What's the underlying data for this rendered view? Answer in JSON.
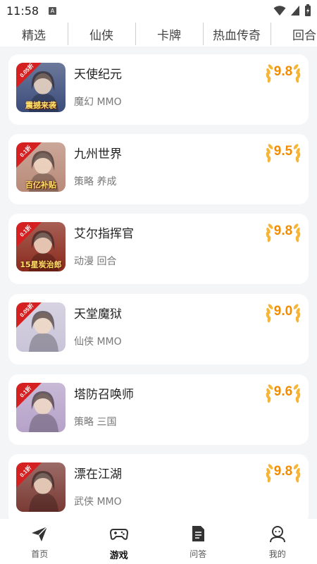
{
  "status_bar": {
    "time": "11:58",
    "notification_icon": "a-notification-icon"
  },
  "tabs": [
    {
      "label": "精选",
      "active": true
    },
    {
      "label": "仙侠",
      "active": false
    },
    {
      "label": "卡牌",
      "active": false
    },
    {
      "label": "热血传奇",
      "active": false
    },
    {
      "label": "回合",
      "active": false
    }
  ],
  "games": [
    {
      "name": "天使纪元",
      "tags": "魔幻 MMO",
      "score": "9.8",
      "badge": "0.05折",
      "overlay": "震撼来袭",
      "color": "#3b4c7a"
    },
    {
      "name": "九州世界",
      "tags": "策略 养成",
      "score": "9.5",
      "badge": "0.1折",
      "overlay": "百亿补贴",
      "color": "#b98a78"
    },
    {
      "name": "艾尔指挥官",
      "tags": "动漫 回合",
      "score": "9.8",
      "badge": "0.1折",
      "overlay": "15星炭治郎",
      "color": "#8a2a1c"
    },
    {
      "name": "天堂魔狱",
      "tags": "仙侠 MMO",
      "score": "9.0",
      "badge": "0.05折",
      "overlay": "",
      "color": "#c9c4d8"
    },
    {
      "name": "塔防召唤师",
      "tags": "策略 三国",
      "score": "9.6",
      "badge": "0.1折",
      "overlay": "",
      "color": "#b6a2c9"
    },
    {
      "name": "漂在江湖",
      "tags": "武侠 MMO",
      "score": "9.8",
      "badge": "0.1折",
      "overlay": "",
      "color": "#7a3a34"
    }
  ],
  "bottom_nav": [
    {
      "label": "首页",
      "icon": "paper-plane-icon",
      "active": false
    },
    {
      "label": "游戏",
      "icon": "gamepad-icon",
      "active": true
    },
    {
      "label": "问答",
      "icon": "document-icon",
      "active": false
    },
    {
      "label": "我的",
      "icon": "user-icon",
      "active": false
    }
  ],
  "colors": {
    "accent_red": "#e02020",
    "score_orange": "#f28c00",
    "laurel_gold": "#f5b638"
  }
}
